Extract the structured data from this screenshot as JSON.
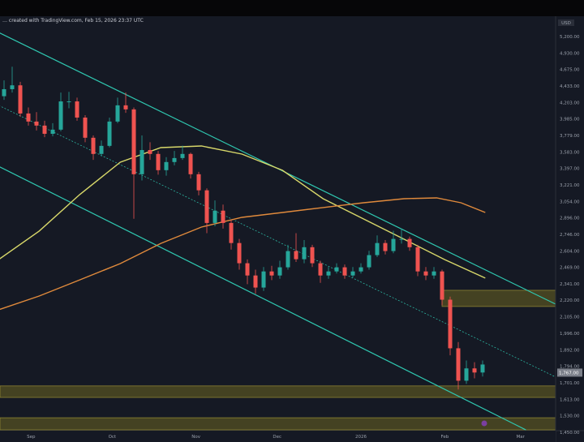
{
  "header": {
    "title": "… created with TradingView.com, Feb 15, 2026 23:37 UTC"
  },
  "chart_data": {
    "type": "candlestick",
    "currency": "USD",
    "y_scale": "log",
    "ylim": [
      1400,
      5300
    ],
    "xlim": [
      "2025-08-20",
      "2026-03-14"
    ],
    "grid": false,
    "colors": {
      "background": "#151924",
      "up": "#26a69a",
      "down": "#ef5350",
      "channel": "#2fc7b0",
      "ma_fast": "#d8d86a",
      "ma_slow": "#e08a3c",
      "zone_fill": "#4a4722",
      "zone_border": "#9a8f35"
    },
    "y_ticks": [
      "5,200.00",
      "4,930.00",
      "4,675.00",
      "4,433.00",
      "4,203.00",
      "3,985.00",
      "3,779.00",
      "3,583.00",
      "3,397.00",
      "3,221.00",
      "3,054.00",
      "2,896.00",
      "2,746.00",
      "2,604.00",
      "2,469.00",
      "2,341.00",
      "2,220.00",
      "2,105.00",
      "1,996.00",
      "1,892.00",
      "1,794.00",
      "1,701.00",
      "1,613.00",
      "1,530.00",
      "1,450.00"
    ],
    "y_tick_values": [
      5200,
      4930,
      4675,
      4433,
      4203,
      3985,
      3779,
      3583,
      3397,
      3221,
      3054,
      2896,
      2746,
      2604,
      2469,
      2341,
      2220,
      2105,
      1996,
      1892,
      1794,
      1701,
      1613,
      1530,
      1450
    ],
    "x_ticks": [
      {
        "label": "Sep",
        "date": "2025-09-01"
      },
      {
        "label": "Oct",
        "date": "2025-10-01"
      },
      {
        "label": "Nov",
        "date": "2025-11-01"
      },
      {
        "label": "Dec",
        "date": "2025-12-01"
      },
      {
        "label": "2026",
        "date": "2026-01-01"
      },
      {
        "label": "Feb",
        "date": "2026-02-01"
      },
      {
        "label": "Mar",
        "date": "2026-03-01"
      }
    ],
    "last_price": {
      "value": 1767,
      "label": "1,767.00"
    },
    "candles_columns": [
      "date",
      "open",
      "high",
      "low",
      "close"
    ],
    "candles": [
      [
        "2025-08-22",
        4200,
        4420,
        4150,
        4296
      ],
      [
        "2025-08-25",
        4296,
        4620,
        4250,
        4350
      ],
      [
        "2025-08-28",
        4350,
        4400,
        3930,
        3972
      ],
      [
        "2025-08-31",
        3972,
        4050,
        3820,
        3870
      ],
      [
        "2025-09-03",
        3870,
        3990,
        3760,
        3820
      ],
      [
        "2025-09-06",
        3820,
        3880,
        3680,
        3720
      ],
      [
        "2025-09-09",
        3720,
        3850,
        3690,
        3770
      ],
      [
        "2025-09-12",
        3770,
        4250,
        3750,
        4130
      ],
      [
        "2025-09-15",
        4130,
        4260,
        4040,
        4130
      ],
      [
        "2025-09-18",
        4130,
        4180,
        3880,
        3920
      ],
      [
        "2025-09-21",
        3920,
        3950,
        3620,
        3673
      ],
      [
        "2025-09-24",
        3673,
        3700,
        3420,
        3486
      ],
      [
        "2025-09-27",
        3486,
        3640,
        3460,
        3578
      ],
      [
        "2025-09-30",
        3578,
        3920,
        3560,
        3870
      ],
      [
        "2025-10-03",
        3870,
        4180,
        3850,
        4078
      ],
      [
        "2025-10-06",
        4078,
        4250,
        3980,
        4025
      ],
      [
        "2025-10-09",
        4025,
        4050,
        2828,
        3265
      ],
      [
        "2025-10-12",
        3265,
        3700,
        3200,
        3530
      ],
      [
        "2025-10-15",
        3530,
        3620,
        3420,
        3486
      ],
      [
        "2025-10-18",
        3486,
        3520,
        3260,
        3308
      ],
      [
        "2025-10-21",
        3308,
        3450,
        3250,
        3396
      ],
      [
        "2025-10-24",
        3396,
        3520,
        3360,
        3440
      ],
      [
        "2025-10-27",
        3440,
        3580,
        3420,
        3486
      ],
      [
        "2025-10-30",
        3486,
        3500,
        3220,
        3265
      ],
      [
        "2025-11-02",
        3265,
        3290,
        3050,
        3100
      ],
      [
        "2025-11-05",
        3100,
        3120,
        2700,
        2790
      ],
      [
        "2025-11-08",
        2790,
        3000,
        2760,
        2903
      ],
      [
        "2025-11-11",
        2903,
        2960,
        2740,
        2790
      ],
      [
        "2025-11-14",
        2790,
        2820,
        2560,
        2615
      ],
      [
        "2025-11-17",
        2615,
        2650,
        2400,
        2450
      ],
      [
        "2025-11-20",
        2450,
        2480,
        2290,
        2355
      ],
      [
        "2025-11-23",
        2355,
        2400,
        2220,
        2265
      ],
      [
        "2025-11-26",
        2265,
        2420,
        2240,
        2386
      ],
      [
        "2025-11-29",
        2386,
        2430,
        2320,
        2355
      ],
      [
        "2025-12-02",
        2355,
        2470,
        2330,
        2418
      ],
      [
        "2025-12-05",
        2418,
        2600,
        2400,
        2548
      ],
      [
        "2025-12-08",
        2548,
        2700,
        2460,
        2482
      ],
      [
        "2025-12-11",
        2482,
        2640,
        2450,
        2580
      ],
      [
        "2025-12-14",
        2580,
        2600,
        2420,
        2450
      ],
      [
        "2025-12-17",
        2450,
        2470,
        2300,
        2355
      ],
      [
        "2025-12-20",
        2355,
        2420,
        2330,
        2386
      ],
      [
        "2025-12-23",
        2386,
        2450,
        2370,
        2418
      ],
      [
        "2025-12-26",
        2418,
        2440,
        2330,
        2355
      ],
      [
        "2025-12-29",
        2355,
        2420,
        2340,
        2386
      ],
      [
        "2026-01-01",
        2386,
        2450,
        2370,
        2418
      ],
      [
        "2026-01-04",
        2418,
        2550,
        2400,
        2515
      ],
      [
        "2026-01-07",
        2515,
        2680,
        2500,
        2615
      ],
      [
        "2026-01-10",
        2615,
        2640,
        2520,
        2548
      ],
      [
        "2026-01-13",
        2548,
        2720,
        2530,
        2650
      ],
      [
        "2026-01-16",
        2650,
        2740,
        2610,
        2650
      ],
      [
        "2026-01-19",
        2650,
        2670,
        2550,
        2580
      ],
      [
        "2026-01-22",
        2580,
        2600,
        2350,
        2386
      ],
      [
        "2026-01-25",
        2386,
        2420,
        2320,
        2355
      ],
      [
        "2026-01-28",
        2355,
        2420,
        2330,
        2386
      ],
      [
        "2026-01-31",
        2386,
        2400,
        2140,
        2178
      ],
      [
        "2026-02-03",
        2178,
        2200,
        1820,
        1862
      ],
      [
        "2026-02-06",
        1862,
        1900,
        1630,
        1677
      ],
      [
        "2026-02-09",
        1677,
        1790,
        1660,
        1745
      ],
      [
        "2026-02-12",
        1745,
        1780,
        1690,
        1722
      ],
      [
        "2026-02-15",
        1722,
        1790,
        1700,
        1767
      ]
    ],
    "channel_lines": [
      {
        "role": "upper",
        "points": [
          [
            "2025-08-20",
            5159
          ],
          [
            "2026-03-14",
            2147
          ]
        ]
      },
      {
        "role": "middle",
        "dashed": true,
        "points": [
          [
            "2025-08-20",
            4078
          ],
          [
            "2026-03-14",
            1697
          ]
        ]
      },
      {
        "role": "lower",
        "points": [
          [
            "2025-08-20",
            3349
          ],
          [
            "2026-03-03",
            1431
          ]
        ]
      }
    ],
    "moving_averages": [
      {
        "role": "ma_fast",
        "points": [
          [
            "2025-08-20",
            2479
          ],
          [
            "2025-09-04",
            2718
          ],
          [
            "2025-09-19",
            3058
          ],
          [
            "2025-10-04",
            3394
          ],
          [
            "2025-10-19",
            3558
          ],
          [
            "2025-11-03",
            3577
          ],
          [
            "2025-11-18",
            3484
          ],
          [
            "2025-12-03",
            3307
          ],
          [
            "2025-12-18",
            3017
          ],
          [
            "2026-01-02",
            2826
          ],
          [
            "2026-01-17",
            2647
          ],
          [
            "2026-02-01",
            2479
          ],
          [
            "2026-02-16",
            2335
          ]
        ]
      },
      {
        "role": "ma_slow",
        "points": [
          [
            "2025-08-20",
            2108
          ],
          [
            "2025-09-04",
            2204
          ],
          [
            "2025-09-19",
            2322
          ],
          [
            "2025-10-04",
            2447
          ],
          [
            "2025-10-19",
            2612
          ],
          [
            "2025-11-03",
            2753
          ],
          [
            "2025-11-18",
            2841
          ],
          [
            "2025-12-03",
            2886
          ],
          [
            "2025-12-18",
            2932
          ],
          [
            "2026-01-02",
            2978
          ],
          [
            "2026-01-17",
            3017
          ],
          [
            "2026-01-29",
            3025
          ],
          [
            "2026-02-07",
            2978
          ],
          [
            "2026-02-16",
            2886
          ]
        ]
      }
    ],
    "zones": [
      {
        "from": "2026-01-31",
        "to": "2026-03-14",
        "low": 2131,
        "high": 2245
      },
      {
        "from": "2025-08-20",
        "to": "2026-03-14",
        "low": 1589,
        "high": 1649
      },
      {
        "from": "2025-08-20",
        "to": "2026-03-14",
        "low": 1431,
        "high": 1488
      }
    ],
    "event_marker": {
      "date": "2026-02-15",
      "icon": "event-flag-icon",
      "color": "#7a3fa0"
    }
  }
}
